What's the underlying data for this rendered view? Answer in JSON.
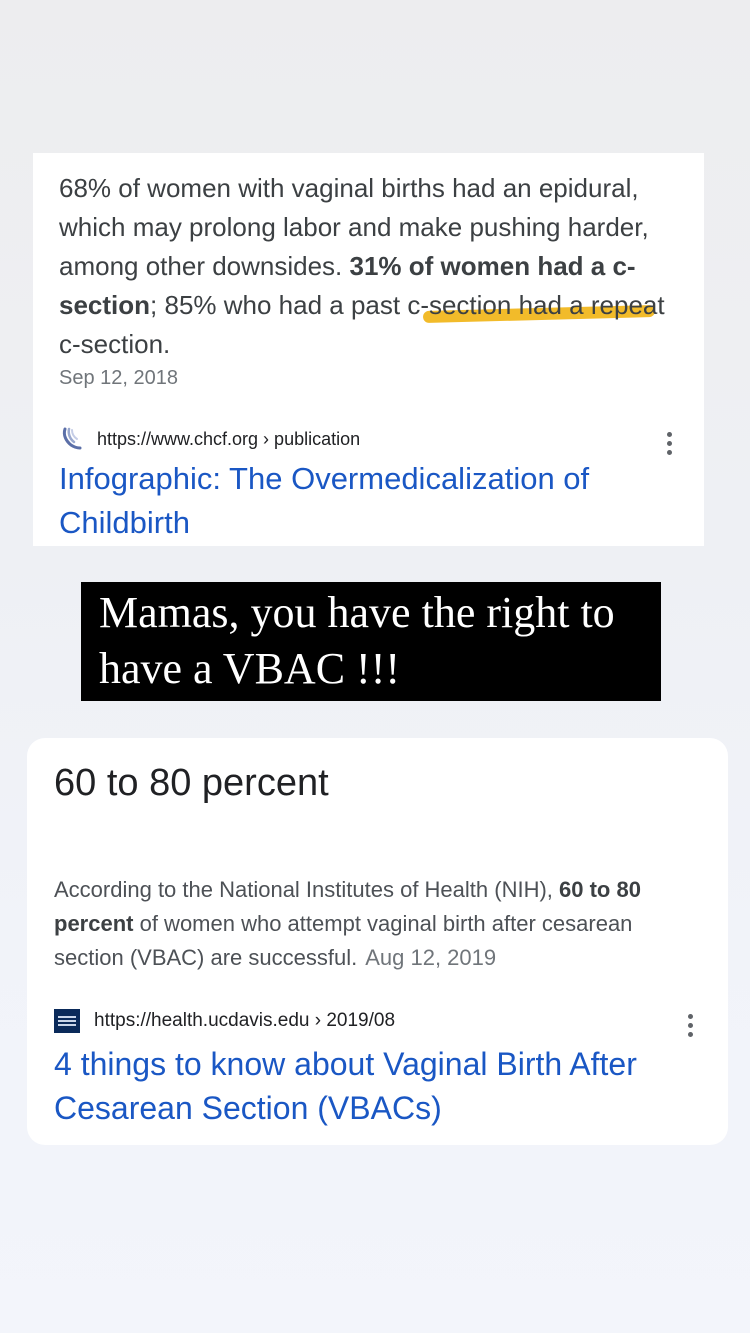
{
  "result1": {
    "snippet_part1": "68% of women with vaginal births had an epidural, which may prolong labor and make pushing harder, among other downsides. ",
    "snippet_bold": "31% of women had a c-section",
    "snippet_part2": "; 85% who had a past c-section had a repeat c-section.",
    "date": "Sep 12, 2018",
    "url": "https://www.chcf.org › publication",
    "title": "Infographic: The Overmedicalization of Childbirth",
    "favicon_icon": "chcf-logo-icon",
    "highlight_color": "#f2bb2a"
  },
  "banner": {
    "text": "Mamas, you have the right to have a VBAC !!!"
  },
  "result2": {
    "answer": "60 to 80 percent",
    "snippet_part1": "According to the National Institutes of Health (NIH), ",
    "snippet_bold": "60 to 80 percent",
    "snippet_part2": " of women who attempt vaginal birth after cesarean section (VBAC) are successful.",
    "date": "Aug 12, 2019",
    "url": "https://health.ucdavis.edu › 2019/08",
    "title": "4 things to know about Vaginal Birth After Cesarean Section (VBACs)",
    "favicon_icon": "ucdavis-health-logo-icon"
  },
  "colors": {
    "link_blue": "#1a57c4",
    "text_gray": "#3c4043",
    "date_gray": "#70757a"
  }
}
